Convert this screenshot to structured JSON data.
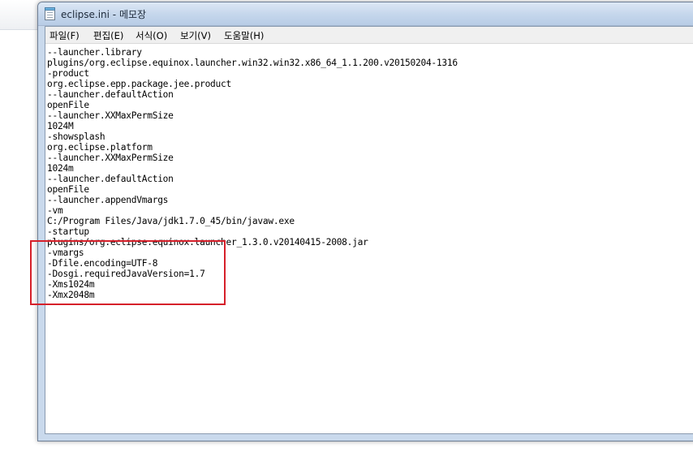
{
  "window": {
    "title": "eclipse.ini - 메모장",
    "icon": "notepad-icon"
  },
  "menu": [
    {
      "label": "파일(F)"
    },
    {
      "label": "편집(E)"
    },
    {
      "label": "서식(O)"
    },
    {
      "label": "보기(V)"
    },
    {
      "label": "도움말(H)"
    }
  ],
  "document": {
    "lines": [
      "--launcher.library",
      "plugins/org.eclipse.equinox.launcher.win32.win32.x86_64_1.1.200.v20150204-1316",
      "-product",
      "org.eclipse.epp.package.jee.product",
      "--launcher.defaultAction",
      "openFile",
      "--launcher.XXMaxPermSize",
      "1024M",
      "-showsplash",
      "org.eclipse.platform",
      "--launcher.XXMaxPermSize",
      "1024m",
      "--launcher.defaultAction",
      "openFile",
      "--launcher.appendVmargs",
      "-vm",
      "C:/Program Files/Java/jdk1.7.0_45/bin/javaw.exe",
      "-startup",
      "plugins/org.eclipse.equinox.launcher_1.3.0.v20140415-2008.jar",
      "-vmargs",
      "-Dfile.encoding=UTF-8",
      "-Dosgi.requiredJavaVersion=1.7",
      "-Xms1024m",
      "-Xmx2048m"
    ]
  },
  "annotation": {
    "color": "#d6202a"
  }
}
